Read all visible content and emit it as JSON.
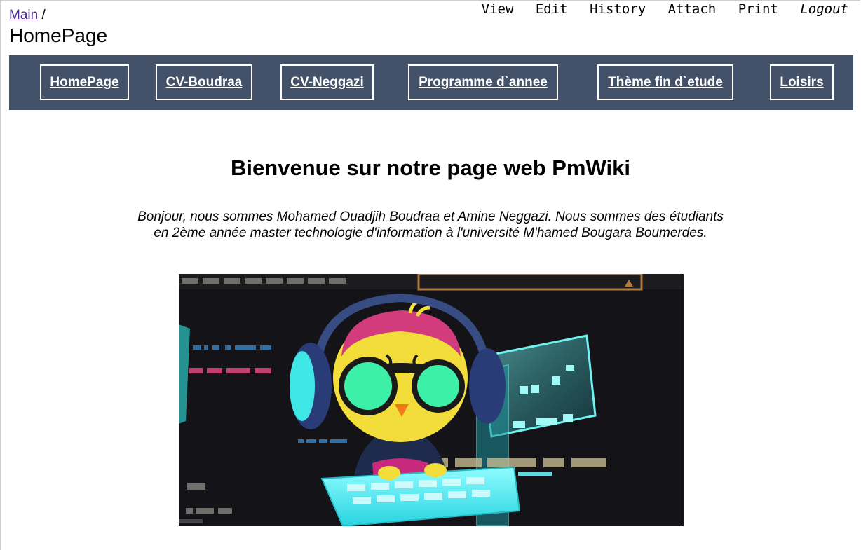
{
  "breadcrumb": {
    "group_link": "Main",
    "separator": "/"
  },
  "page": {
    "title": "HomePage"
  },
  "page_actions": {
    "view": "View",
    "edit": "Edit",
    "history": "History",
    "attach": "Attach",
    "print": "Print",
    "logout": "Logout"
  },
  "nav": {
    "items": [
      {
        "label": "HomePage"
      },
      {
        "label": "CV-Boudraa"
      },
      {
        "label": "CV-Neggazi"
      },
      {
        "label": "Programme d`annee"
      },
      {
        "label": "Thème fin d`etude"
      },
      {
        "label": "Loisirs"
      }
    ]
  },
  "content": {
    "heading": "Bienvenue sur notre page web PmWiki",
    "intro_line1": "Bonjour, nous sommes Mohamed Ouadjih Boudraa et Amine Neggazi. Nous sommes des étudiants",
    "intro_line2": "en 2ème année master technologie d'information à l'université M'hamed Bougara Boumerdes."
  },
  "colors": {
    "navbar_bg": "#435268",
    "link_visited": "#4b2596",
    "hologram_cyan": "#3ee6e6"
  },
  "icons": {
    "hero_image": "hacker-bird-illustration"
  }
}
